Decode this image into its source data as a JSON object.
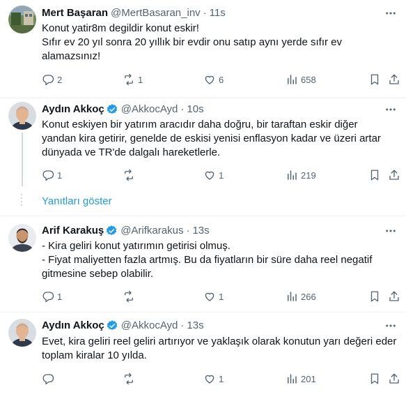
{
  "colors": {
    "text": "#0f1419",
    "secondary": "#536471",
    "link": "#1d9bf0",
    "verified": "#1d9bf0",
    "divider": "#eff3f4"
  },
  "tweets": [
    {
      "name": "Mert Başaran",
      "handle": "@MertBasaran_inv",
      "time": "11s",
      "verified": false,
      "lines": [
        "Konut yatir8m degildir konut eskir!",
        "Sıfır ev 20 yıl sonra 20 yıllık bir evdir onu satıp aynı yerde sıfır ev",
        "alamazsınız!"
      ],
      "replies": "2",
      "retweets": "1",
      "likes": "6",
      "views": "658"
    },
    {
      "name": "Aydın Akkoç",
      "handle": "@AkkocAyd",
      "time": "10s",
      "verified": true,
      "lines": [
        "Konut eskiyen bir yatırım aracıdır daha doğru, bir taraftan eskir diğer",
        "yandan kira getirir, genelde de eskisi yenisi enflasyon kadar ve üzeri artar",
        "dünyada ve TR'de dalgalı hareketlerle."
      ],
      "replies": "1",
      "retweets": "",
      "likes": "1",
      "views": "219"
    },
    {
      "name": "Arif Karakuş",
      "handle": "@Arifkarakus",
      "time": "13s",
      "verified": true,
      "lines": [
        "- Kira geliri konut yatırımın getirisi olmuş.",
        "- Fiyat maliyetten fazla artmış. Bu da fiyatların bir süre daha reel negatif",
        "gitmesine sebep olabilir."
      ],
      "replies": "1",
      "retweets": "",
      "likes": "1",
      "views": "266"
    },
    {
      "name": "Aydın Akkoç",
      "handle": "@AkkocAyd",
      "time": "13s",
      "verified": true,
      "lines": [
        "Evet, kira geliri reel geliri artırıyor ve yaklaşık olarak konutun yarı değeri eder",
        "toplam kiralar 10 yılda."
      ],
      "replies": "",
      "retweets": "",
      "likes": "1",
      "views": "201"
    }
  ],
  "show_replies_label": "Yanıtları göster",
  "separator": "·",
  "icons": {
    "more": "more-icon",
    "reply": "reply-icon",
    "retweet": "retweet-icon",
    "like": "like-icon",
    "views": "views-icon",
    "bookmark": "bookmark-icon",
    "share": "share-icon",
    "verified": "verified-badge-icon"
  }
}
